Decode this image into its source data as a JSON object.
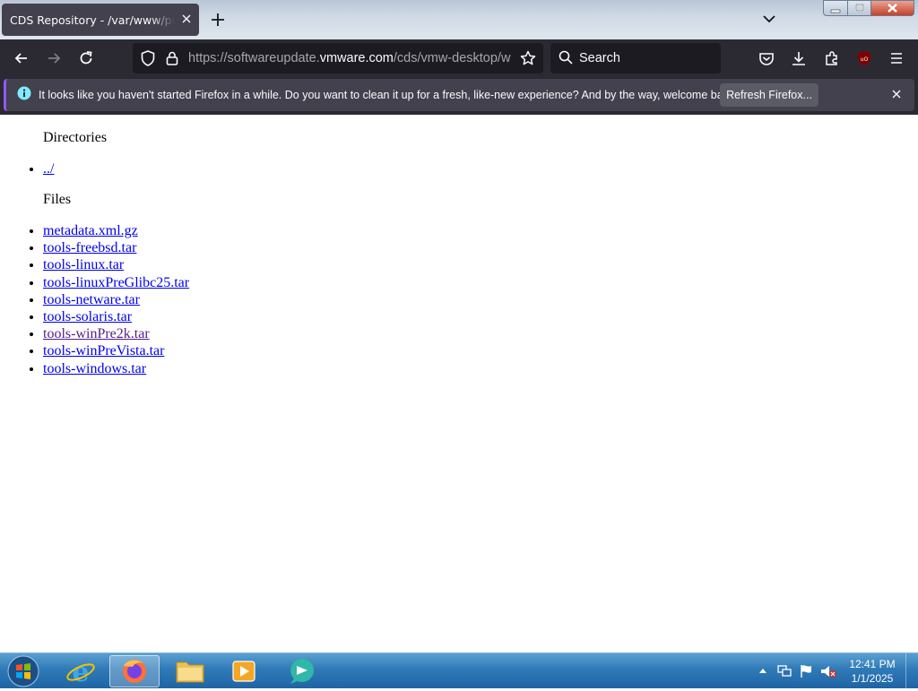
{
  "browser": {
    "tab_title": "CDS Repository - /var/www/public/",
    "url_prefix": "https://softwareupdate.",
    "url_host": "vmware.com",
    "url_path": "/cds/vmw-desktop/ws/",
    "search_placeholder": "Search"
  },
  "notification": {
    "message": "It looks like you haven't started Firefox in a while. Do you want to clean it up for a fresh, like-new experience? And by the way, welcome back!",
    "button_label": "Refresh Firefox..."
  },
  "page": {
    "directories_heading": "Directories",
    "directories": [
      "../"
    ],
    "files_heading": "Files",
    "files": [
      "metadata.xml.gz",
      "tools-freebsd.tar",
      "tools-linux.tar",
      "tools-linuxPreGlibc25.tar",
      "tools-netware.tar",
      "tools-solaris.tar",
      "tools-winPre2k.tar",
      "tools-winPreVista.tar",
      "tools-windows.tar"
    ],
    "visited_file": "tools-winPre2k.tar"
  },
  "taskbar": {
    "time": "12:41 PM",
    "date": "1/1/2025"
  },
  "colors": {
    "link": "#0000ee",
    "visited_link": "#551a8b",
    "toolbar": "#2b2a33",
    "accent": "#9059ff"
  }
}
